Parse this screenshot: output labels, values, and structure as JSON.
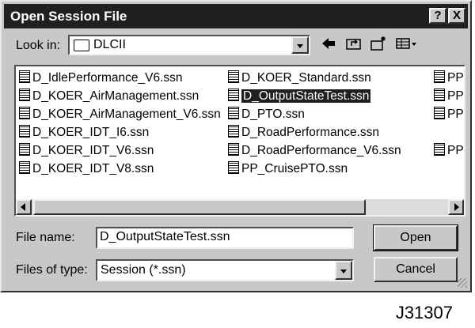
{
  "dialog": {
    "title": "Open Session File",
    "help_label": "?",
    "close_label": "X"
  },
  "lookin": {
    "label": "Look in:",
    "value": "DLCII"
  },
  "files": {
    "col1": [
      "D_IdlePerformance_V6.ssn",
      "D_KOER_AirManagement.ssn",
      "D_KOER_AirManagement_V6.ssn",
      "D_KOER_IDT_I6.ssn",
      "D_KOER_IDT_V6.ssn",
      "D_KOER_IDT_V8.ssn"
    ],
    "col2": [
      "D_KOER_Standard.ssn",
      "D_OutputStateTest.ssn",
      "D_PTO.ssn",
      "D_RoadPerformance.ssn",
      "D_RoadPerformance_V6.ssn",
      "PP_CruisePTO.ssn"
    ],
    "col3": [
      "PP",
      "PP",
      "PP",
      "PP"
    ],
    "selected": "D_OutputStateTest.ssn"
  },
  "filename": {
    "label": "File name:",
    "value": "D_OutputStateTest.ssn"
  },
  "filetype": {
    "label": "Files of type:",
    "value": "Session (*.ssn)"
  },
  "buttons": {
    "open": "Open",
    "cancel": "Cancel"
  },
  "caption": "J31307"
}
